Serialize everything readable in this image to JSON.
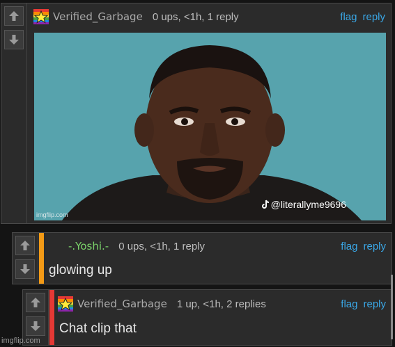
{
  "comments": [
    {
      "username": "Verified_Garbage",
      "meta": "0 ups, <1h, 1 reply",
      "flag": "flag",
      "reply": "reply",
      "has_avatar": true
    },
    {
      "username": "-.Yoshi.-",
      "meta": "0 ups, <1h, 1 reply",
      "flag": "flag",
      "reply": "reply",
      "text": "glowing up",
      "accent": "#f39a16"
    },
    {
      "username": "Verified_Garbage",
      "meta": "1 up, <1h, 2 replies",
      "flag": "flag",
      "reply": "reply",
      "text": "Chat clip that",
      "accent": "#e53935",
      "has_avatar": true
    }
  ],
  "meme": {
    "watermark_left": "imgflip.com",
    "caption": "@literallyme9696"
  },
  "footer": {
    "watermark": "imgflip.com"
  },
  "icons": {
    "up": "arrow-up-icon",
    "down": "arrow-down-icon",
    "avatar": "star-flag-avatar-icon",
    "tiktok": "tiktok-icon"
  }
}
